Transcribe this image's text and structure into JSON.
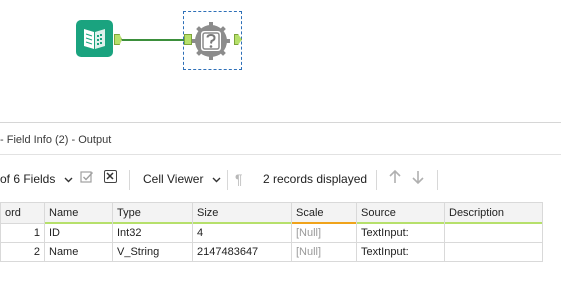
{
  "canvas": {
    "tools": [
      {
        "name": "Text Input",
        "icon": "book-icon",
        "color": "#1aa37f"
      },
      {
        "name": "Field Info",
        "icon": "gear-question-icon",
        "color": "#8c8c8c"
      }
    ]
  },
  "results": {
    "title": "- Field Info (2) - Output",
    "toolbar": {
      "fields_label": "of 6 Fields",
      "viewer_label": "Cell Viewer",
      "records_label": "2 records displayed"
    },
    "columns": [
      "ord",
      "Name",
      "Type",
      "Size",
      "Scale",
      "Source",
      "Description"
    ],
    "rows": [
      [
        "1",
        "ID",
        "Int32",
        "4",
        "[Null]",
        "TextInput:",
        ""
      ],
      [
        "2",
        "Name",
        "V_String",
        "2147483647",
        "[Null]",
        "TextInput:",
        ""
      ]
    ]
  },
  "colors": {
    "accent_green": "#b6e06b",
    "scale_orange": "#f0a31b",
    "selection_blue": "#2d6fb7"
  }
}
